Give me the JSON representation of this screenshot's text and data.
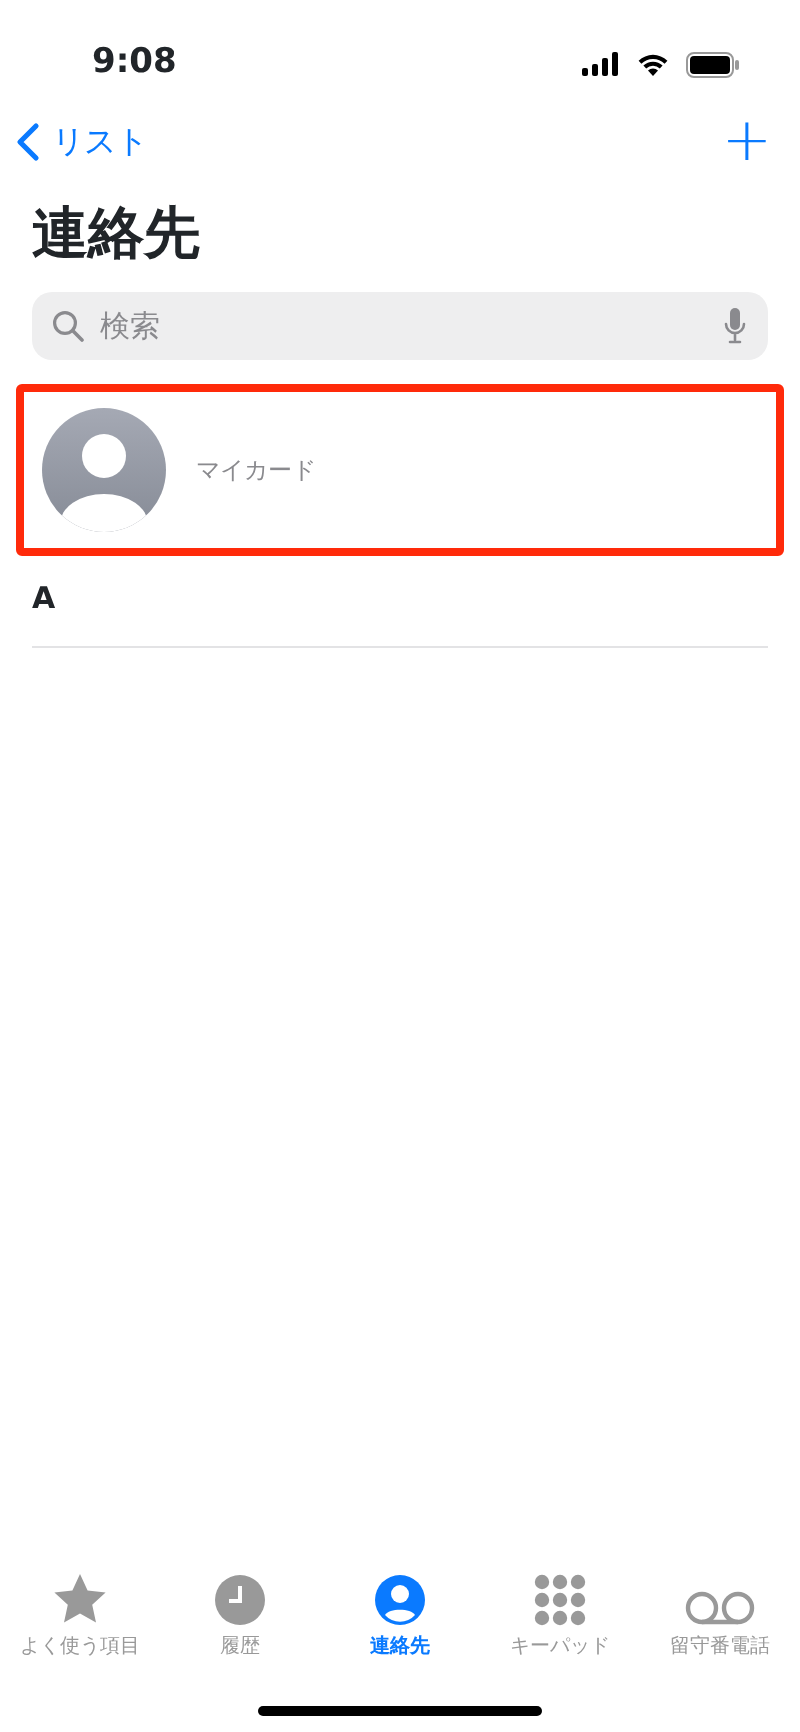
{
  "status_bar": {
    "time": "9:08"
  },
  "nav": {
    "back_label": "リスト",
    "add": "+"
  },
  "title": "連絡先",
  "search": {
    "placeholder": "検索"
  },
  "my_card": {
    "label": "マイカード",
    "highlighted": true
  },
  "sections": [
    {
      "letter": "A"
    }
  ],
  "tab_bar": [
    {
      "kind": "star",
      "label": "よく使う項目",
      "selected": false
    },
    {
      "kind": "clock",
      "label": "履歴",
      "selected": false
    },
    {
      "kind": "person",
      "label": "連絡先",
      "selected": true
    },
    {
      "kind": "keypad",
      "label": "キーパッド",
      "selected": false
    },
    {
      "kind": "voicemail",
      "label": "留守番電話",
      "selected": false
    }
  ]
}
